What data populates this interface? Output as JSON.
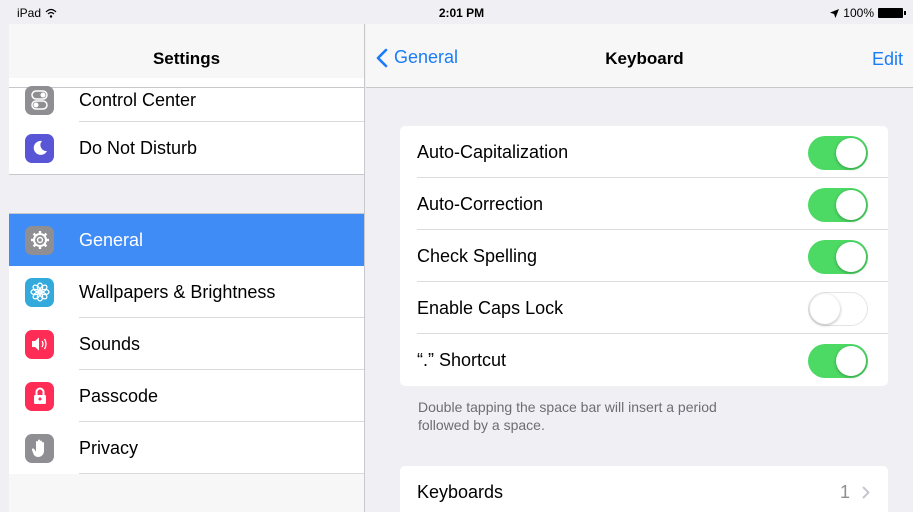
{
  "status_bar": {
    "device": "iPad",
    "time": "2:01 PM",
    "battery": "100%"
  },
  "sidebar": {
    "title": "Settings",
    "group1": [
      {
        "label": "Control Center",
        "icon": "control-center-icon",
        "color": "#8e8e93"
      },
      {
        "label": "Do Not Disturb",
        "icon": "moon-icon",
        "color": "#5856d6"
      }
    ],
    "group2": [
      {
        "label": "General",
        "icon": "gear-icon",
        "color": "#8e8e93",
        "selected": true
      },
      {
        "label": "Wallpapers & Brightness",
        "icon": "flower-icon",
        "color": "#34aadc"
      },
      {
        "label": "Sounds",
        "icon": "speaker-icon",
        "color": "#ff2d55"
      },
      {
        "label": "Passcode",
        "icon": "lock-icon",
        "color": "#ff2d55"
      },
      {
        "label": "Privacy",
        "icon": "hand-icon",
        "color": "#8e8e93"
      }
    ]
  },
  "detail": {
    "back_label": "General",
    "title": "Keyboard",
    "edit_label": "Edit",
    "toggles": [
      {
        "label": "Auto-Capitalization",
        "on": true
      },
      {
        "label": "Auto-Correction",
        "on": true
      },
      {
        "label": "Check Spelling",
        "on": true
      },
      {
        "label": "Enable Caps Lock",
        "on": false
      },
      {
        "label": "“.” Shortcut",
        "on": true
      }
    ],
    "footnote": "Double tapping the space bar will insert a period followed by a space.",
    "keyboards": {
      "label": "Keyboards",
      "count": "1"
    }
  },
  "colors": {
    "accent": "#1a7cf7",
    "selection": "#3f8cf6",
    "switch_on": "#4cd964"
  }
}
